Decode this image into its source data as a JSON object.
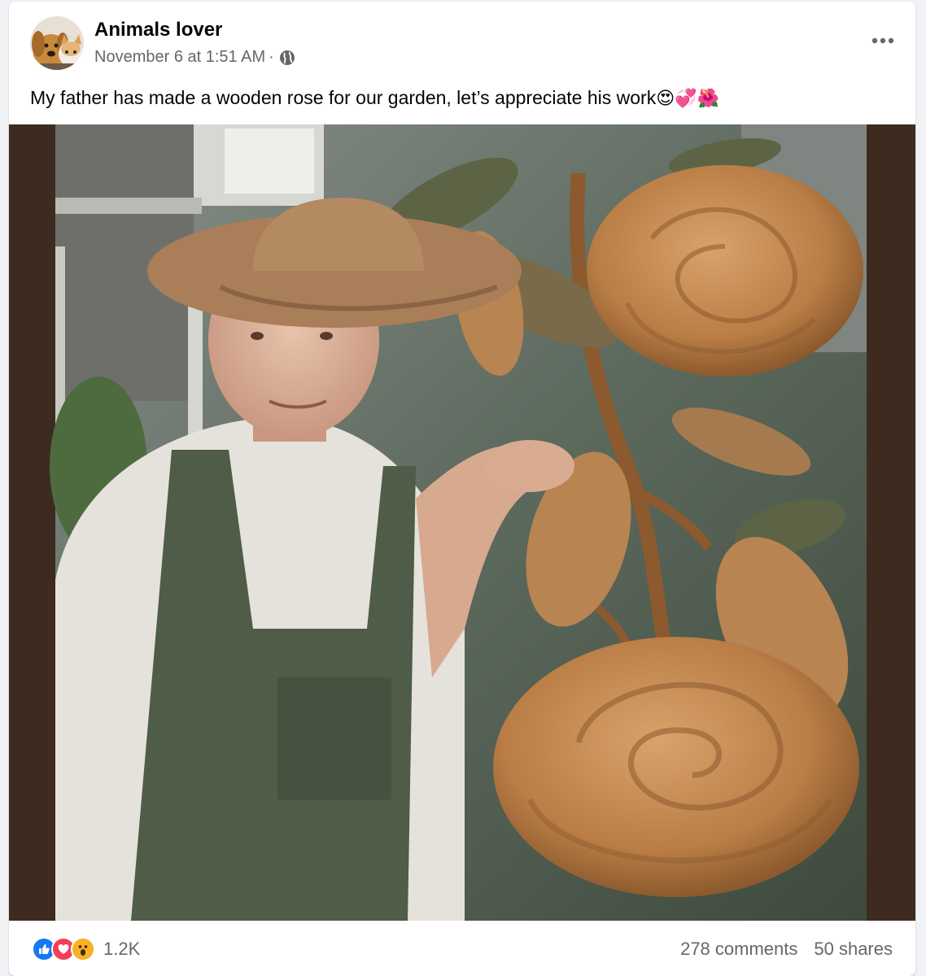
{
  "post": {
    "author": "Animals lover",
    "timestamp": "November 6 at 1:51 AM",
    "separator": "·",
    "audience_icon": "globe-icon",
    "more_icon": "more-horizontal-icon",
    "caption": "My father has made a wooden rose for our garden, let’s appreciate his work",
    "caption_emojis": "😍💞🌺",
    "reactions": {
      "icons": [
        "like-icon",
        "love-icon",
        "wow-icon"
      ],
      "count": "1.2K"
    },
    "comments": "278 comments",
    "shares": "50 shares"
  },
  "colors": {
    "like": "#1877f2",
    "love": "#f33e58",
    "wow": "#f7b125",
    "photo_border": "#3d2b1f",
    "muted_text": "#65676b"
  }
}
